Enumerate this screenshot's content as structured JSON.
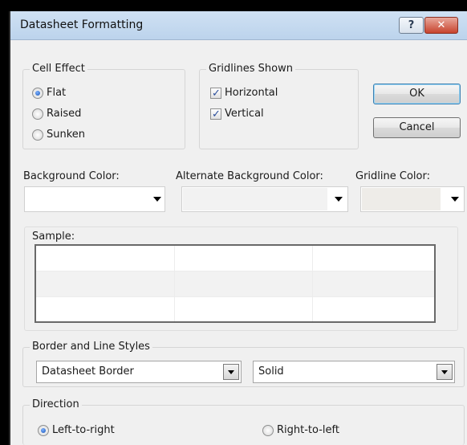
{
  "window": {
    "title": "Datasheet Formatting",
    "help_label": "?",
    "close_label": "✕"
  },
  "cell_effect": {
    "legend": "Cell Effect",
    "options": [
      {
        "label": "Flat",
        "checked": true
      },
      {
        "label": "Raised",
        "checked": false
      },
      {
        "label": "Sunken",
        "checked": false
      }
    ]
  },
  "gridlines": {
    "legend": "Gridlines Shown",
    "options": [
      {
        "label": "Horizontal",
        "checked": true
      },
      {
        "label": "Vertical",
        "checked": true
      }
    ]
  },
  "buttons": {
    "ok": "OK",
    "cancel": "Cancel"
  },
  "colors": {
    "background_label": "Background Color:",
    "background_value": "#ffffff",
    "alternate_label": "Alternate Background Color:",
    "alternate_value": "#f2f2f2",
    "gridline_label": "Gridline Color:",
    "gridline_value": "#eeece8"
  },
  "sample": {
    "legend": "Sample:",
    "rows": 3,
    "columns": 3
  },
  "border_styles": {
    "legend": "Border and Line Styles",
    "border_value": "Datasheet Border",
    "line_value": "Solid"
  },
  "direction": {
    "legend": "Direction",
    "options": [
      {
        "label": "Left-to-right",
        "checked": true
      },
      {
        "label": "Right-to-left",
        "checked": false
      }
    ]
  }
}
